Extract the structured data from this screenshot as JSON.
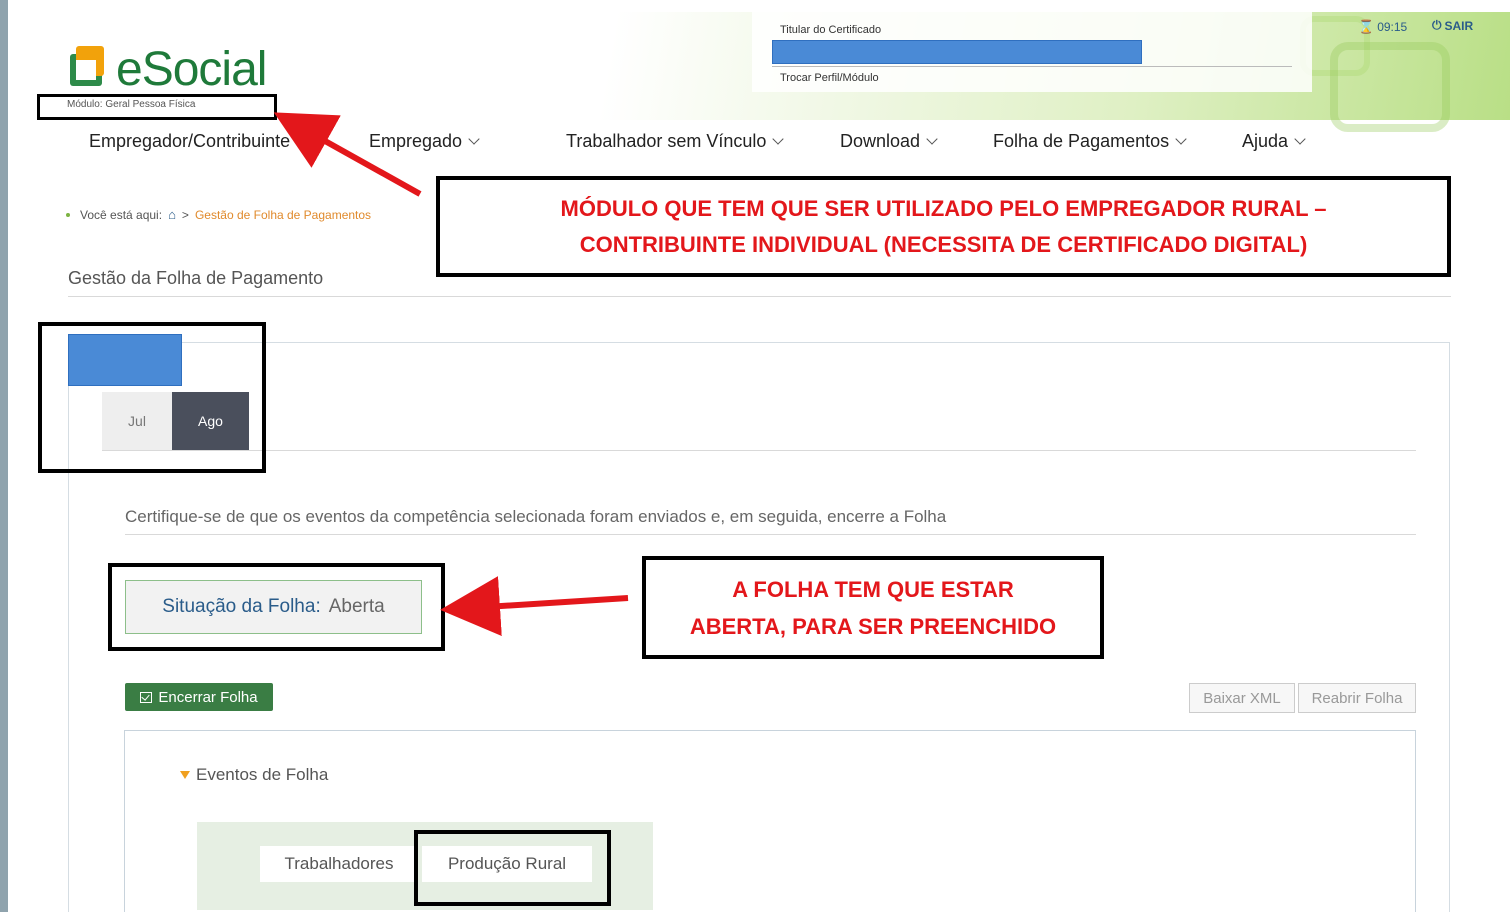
{
  "header": {
    "logo_text": "eSocial",
    "module": "Módulo: Geral Pessoa Física",
    "cert_title": "Titular do Certificado",
    "cert_link": "Trocar Perfil/Módulo",
    "timer": "09:15",
    "logout": "SAIR"
  },
  "nav": {
    "items": [
      {
        "label": "Empregador/Contribuinte"
      },
      {
        "label": "Empregado"
      },
      {
        "label": "Trabalhador sem Vínculo"
      },
      {
        "label": "Download"
      },
      {
        "label": "Folha de Pagamentos"
      },
      {
        "label": "Ajuda"
      }
    ]
  },
  "breadcrumb": {
    "prefix": "Você está aqui:",
    "separator": ">",
    "current": "Gestão de Folha de Pagamentos"
  },
  "page": {
    "title": "Gestão da Folha de Pagamento",
    "months": [
      "Jul",
      "Ago"
    ],
    "selected_month": "Ago",
    "instruction": "Certifique-se de que os eventos da competência selecionada foram enviados e, em seguida, encerre a Folha",
    "status_label": "Situação da Folha:",
    "status_value": "Aberta",
    "btn_close": "Encerrar Folha",
    "btn_xml": "Baixar XML",
    "btn_reopen": "Reabrir Folha",
    "events_title": "Eventos de Folha",
    "tabs": [
      "Trabalhadores",
      "Produção Rural"
    ]
  },
  "annotations": {
    "callout1_line1": "MÓDULO QUE TEM QUE SER UTILIZADO PELO EMPREGADOR RURAL –",
    "callout1_line2": "CONTRIBUINTE INDIVIDUAL (NECESSITA DE CERTIFICADO DIGITAL)",
    "callout2_line1": "A FOLHA TEM QUE ESTAR",
    "callout2_line2": "ABERTA, PARA SER PREENCHIDO"
  },
  "colors": {
    "brand_green": "#1f7a3a",
    "nav_blue": "#2a5c8a",
    "breadcrumb_orange": "#e08a2c",
    "annotation_red": "#e3171b",
    "redaction_blue": "#4a8ad6",
    "selected_month_bg": "#4a4f5c"
  }
}
